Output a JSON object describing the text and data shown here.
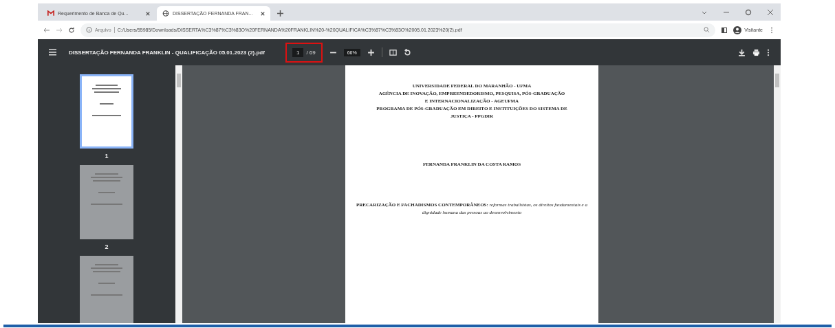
{
  "tabs": [
    {
      "title": "Requerimento de Banca de Qu...",
      "selected": false
    },
    {
      "title": "DISSERTAÇÃO FERNANDA FRAN...",
      "selected": true
    }
  ],
  "address_bar": {
    "scheme": "Arquivo",
    "url": "C:/Users/55985/Downloads/DISSERTA%C3%87%C3%83O%20FERNANDA%20FRANKLIN%20-%20QUALIFICA%C3%87%C3%83O%2005.01.2023%20(2).pdf"
  },
  "profile": {
    "label": "Visitante"
  },
  "pdf_toolbar": {
    "title": "DISSERTAÇÃO FERNANDA FRANKLIN - QUALIFICAÇÃO 05.01.2023 (2).pdf",
    "page": "1",
    "page_count": "/ 69",
    "zoom": "66%"
  },
  "thumbnails": [
    {
      "label": "1",
      "selected": true
    },
    {
      "label": "2",
      "selected": false
    },
    {
      "selected": false
    }
  ],
  "document": {
    "header": [
      "UNIVERSIDADE FEDERAL DO MARANHÃO - UFMA",
      "AGÊNCIA DE INOVAÇÃO, EMPREENDEDORISMO, PESQUISA, PÓS-GRADUAÇÃO",
      "E INTERNACIONALIZAÇÃO - AGEUFMA",
      "PROGRAMA DE PÓS-GRADUAÇÃO EM DIREITO E INSTITUIÇÕES DO SISTEMA DE",
      "JUSTIÇA - PPGDIR"
    ],
    "author": "FERNANDA FRANKLIN DA COSTA RAMOS",
    "title": "**PRECARIZAÇÃO E FACHADISMOS CONTEMPORÂNEOS:** *reformas trabalhistas, os direitos fundamentais e a dignidade humana das pessoas ao desenvolvimento*"
  }
}
